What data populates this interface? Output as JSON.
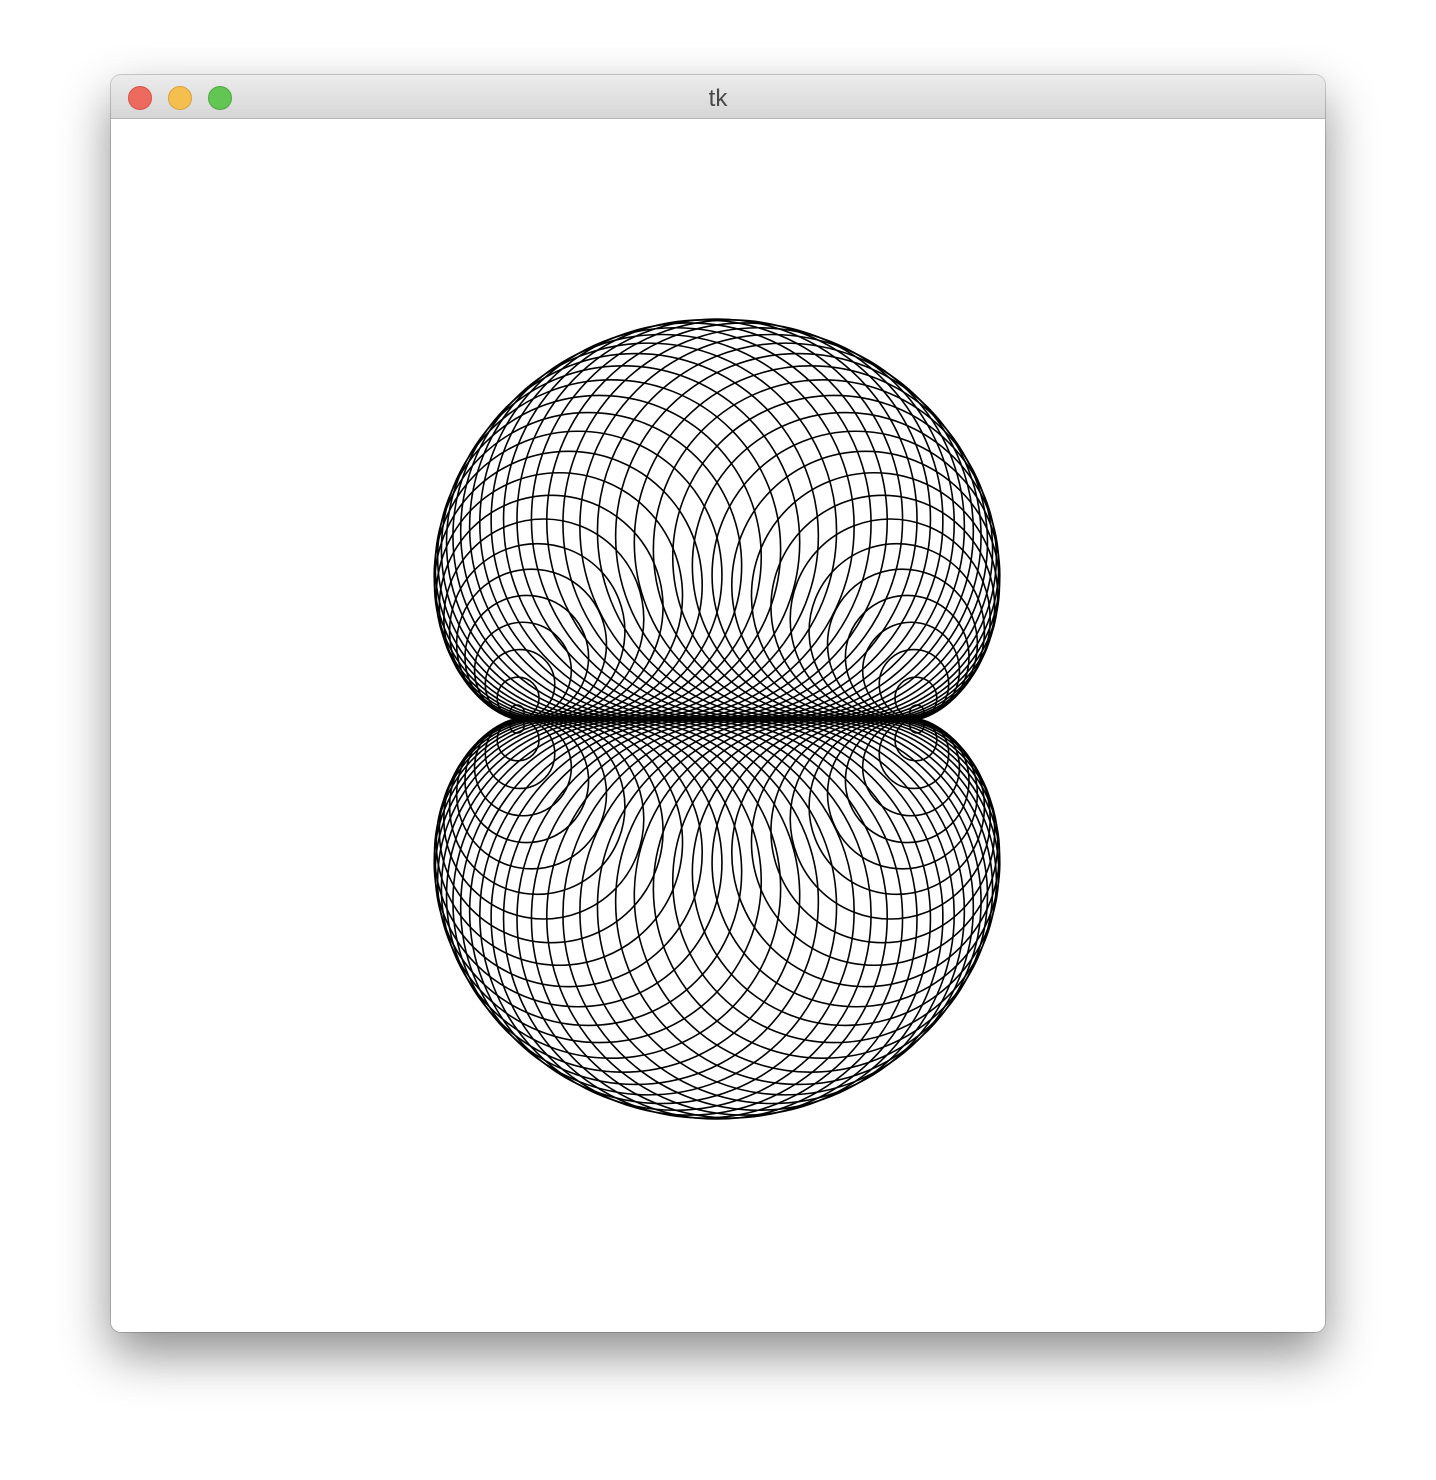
{
  "window": {
    "title": "tk",
    "controls": {
      "close_color": "#ed6a5e",
      "minimize_color": "#f5bf4f",
      "zoom_color": "#62c554"
    }
  },
  "canvas": {
    "background": "#ffffff",
    "stroke_color": "#000000",
    "drawing": "circle-pattern"
  }
}
